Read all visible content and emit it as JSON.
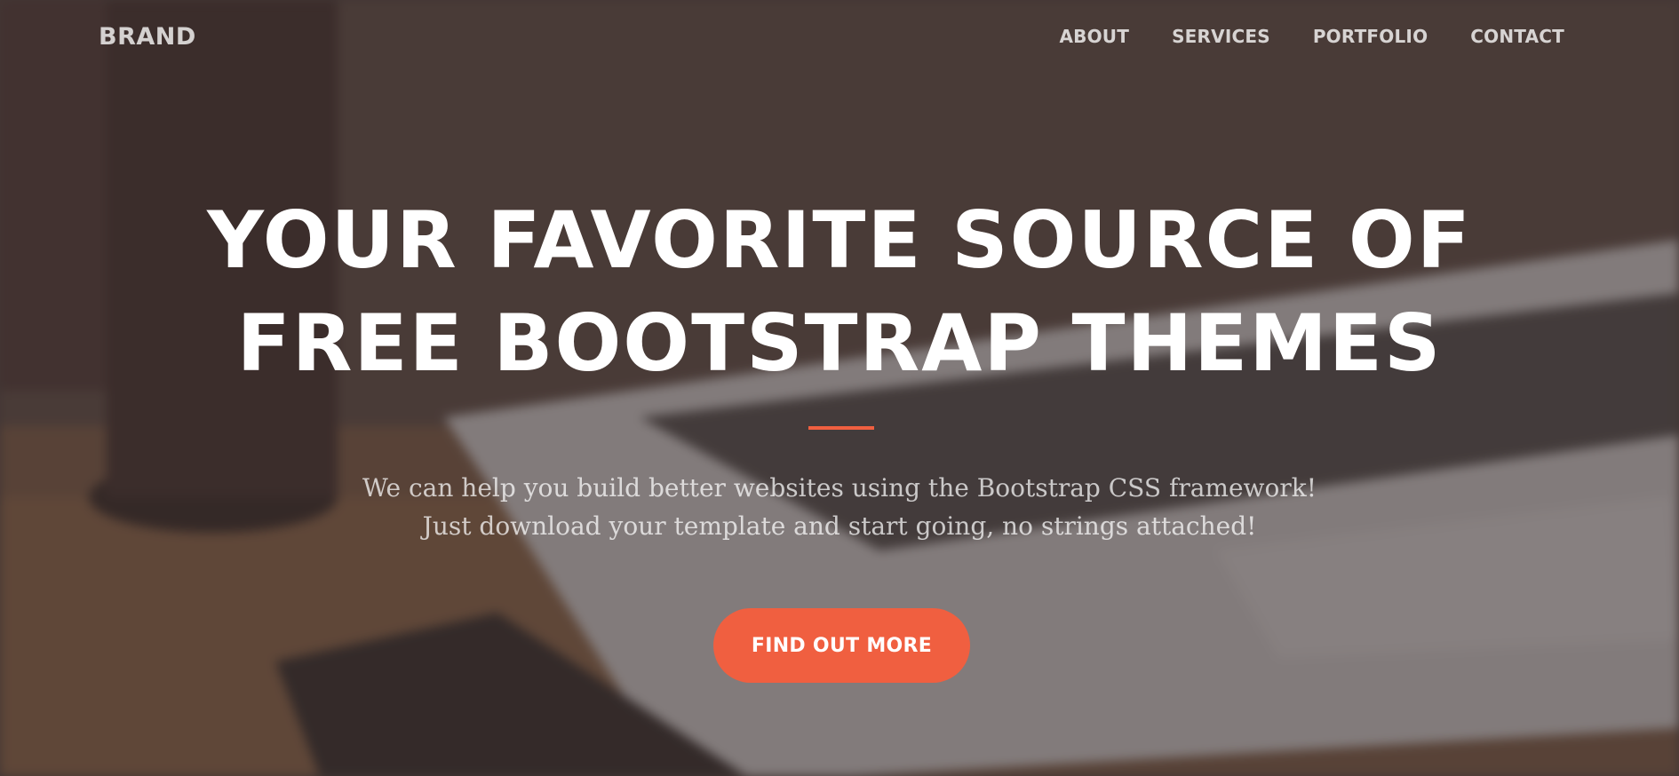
{
  "navbar": {
    "brand": "BRAND",
    "links": [
      {
        "label": "ABOUT"
      },
      {
        "label": "SERVICES"
      },
      {
        "label": "PORTFOLIO"
      },
      {
        "label": "CONTACT"
      }
    ]
  },
  "hero": {
    "title_line1": "YOUR FAVORITE SOURCE OF",
    "title_line2": "FREE BOOTSTRAP THEMES",
    "text": "We can help you build better websites using the Bootstrap CSS framework! Just download your template and start going, no strings attached!",
    "button_label": "FIND OUT MORE"
  },
  "colors": {
    "accent": "#f05f40",
    "overlay": "#3c302e"
  }
}
